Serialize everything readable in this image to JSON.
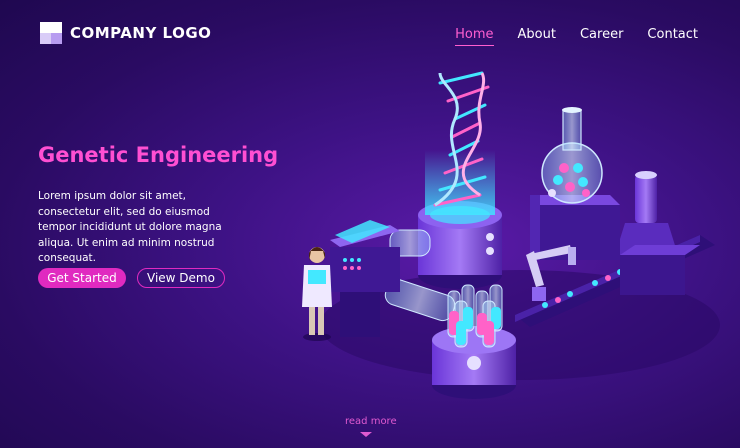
{
  "header": {
    "logo_text": "COMPANY LOGO",
    "nav": [
      {
        "label": "Home",
        "active": true
      },
      {
        "label": "About",
        "active": false
      },
      {
        "label": "Career",
        "active": false
      },
      {
        "label": "Contact",
        "active": false
      }
    ]
  },
  "hero": {
    "title": "Genetic Engineering",
    "description": "Lorem ipsum dolor sit amet, consectetur elit, sed do eiusmod tempor incididunt ut dolore magna aliqua. Ut enim ad minim nostrud consequat.",
    "primary_button": "Get Started",
    "secondary_button": "View Demo"
  },
  "footer": {
    "read_more": "read more",
    "read_more_icon": "chevron-down-icon"
  },
  "colors": {
    "accent": "#e02ac0",
    "title": "#ff4fd2",
    "background": "#3d1284"
  }
}
